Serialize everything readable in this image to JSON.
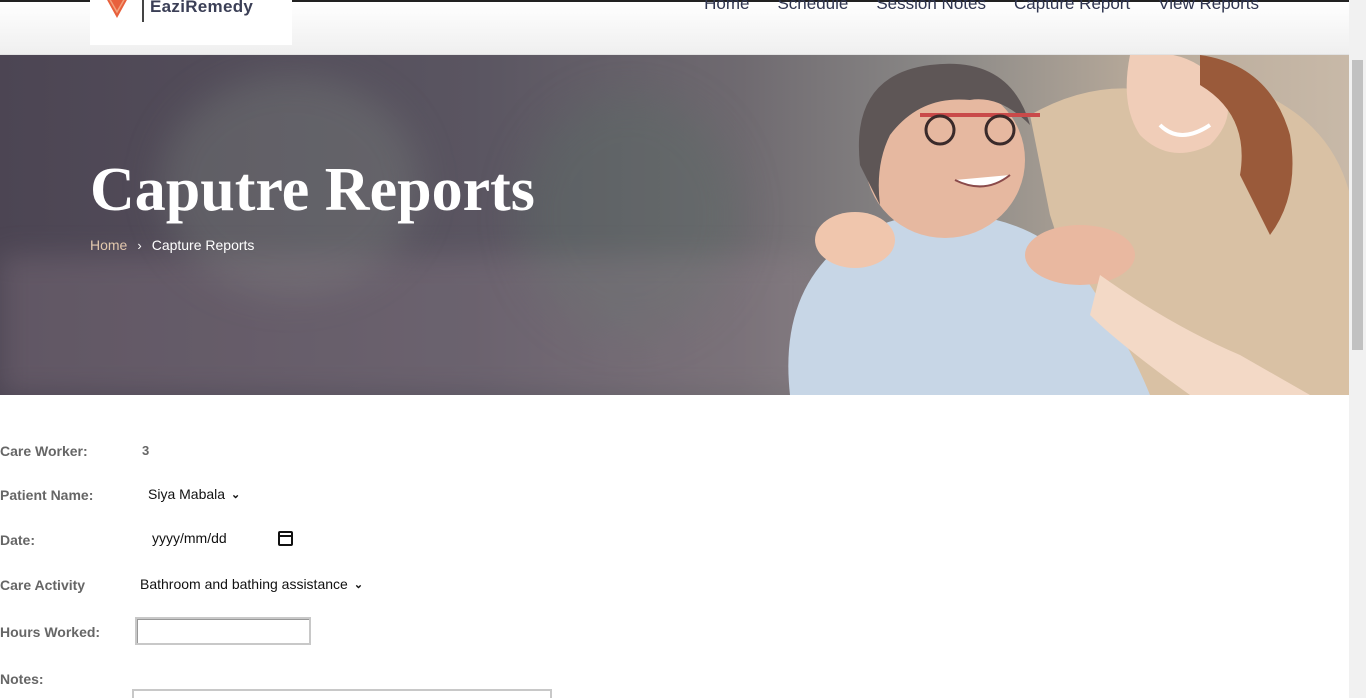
{
  "brand": {
    "name": "EaziRemedy",
    "accent": "#e8603c"
  },
  "nav": {
    "items": [
      "Home",
      "Schedule",
      "Session Notes",
      "Capture Report",
      "View Reports"
    ]
  },
  "hero": {
    "title": "Caputre Reports",
    "breadcrumb": {
      "home": "Home",
      "separator": "›",
      "current": "Capture Reports"
    }
  },
  "form": {
    "care_worker": {
      "label": "Care Worker:",
      "value": "3"
    },
    "patient_name": {
      "label": "Patient Name:",
      "value": "Siya Mabala"
    },
    "date": {
      "label": "Date:",
      "placeholder": "yyyy/mm/dd"
    },
    "care_activity": {
      "label": "Care Activity",
      "value": "Bathroom and bathing assistance"
    },
    "hours_worked": {
      "label": "Hours Worked:",
      "value": ""
    },
    "notes": {
      "label": "Notes:",
      "value": ""
    }
  },
  "icons": {
    "logo": "heart-logo-icon",
    "breadcrumb_separator": "chevron-right-icon",
    "select_arrow": "chevron-down-icon",
    "calendar": "calendar-icon"
  }
}
